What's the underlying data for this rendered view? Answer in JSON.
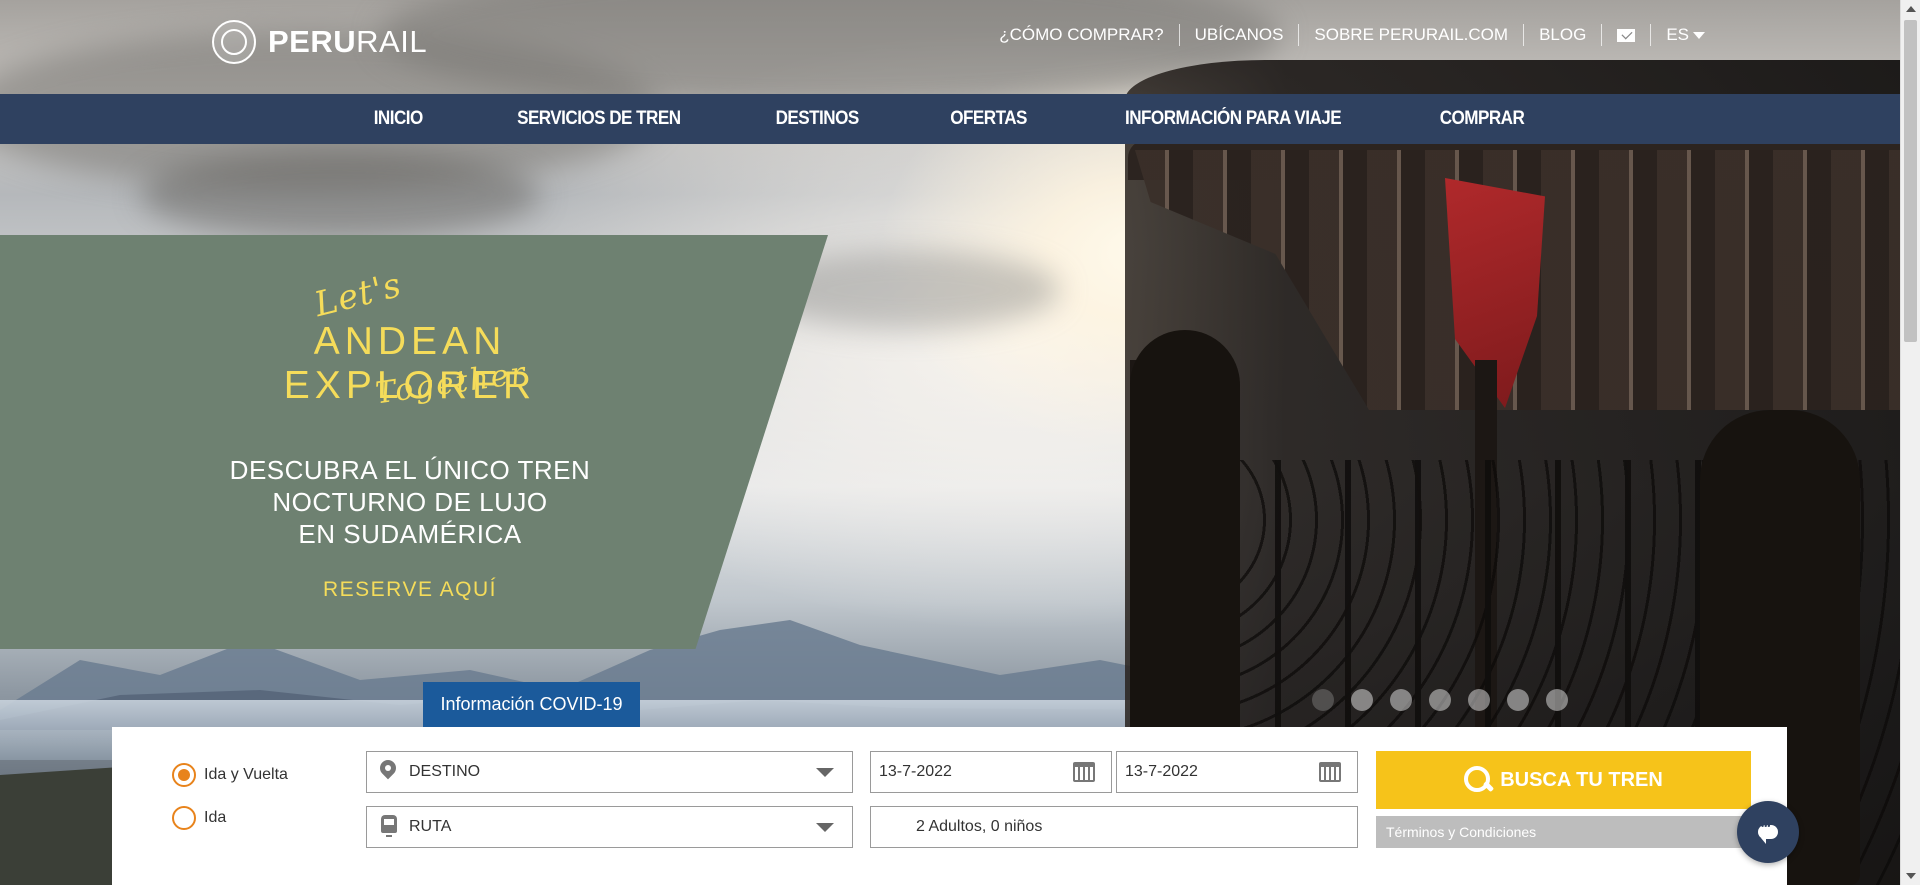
{
  "brand": {
    "name_bold": "PERU",
    "name_rest": "RAIL"
  },
  "top_links": {
    "how_to_buy": "¿CÓMO COMPRAR?",
    "locate_us": "UBÍCANOS",
    "about": "SOBRE PERURAIL.COM",
    "blog": "BLOG",
    "language": "ES",
    "mail_icon": "mail-icon"
  },
  "nav": {
    "items": [
      "INICIO",
      "SERVICIOS DE TREN",
      "DESTINOS",
      "OFERTAS",
      "INFORMACIÓN PARA VIAJE",
      "COMPRAR"
    ]
  },
  "promo": {
    "lets": "Let's",
    "title": "ANDEAN EXPLORER",
    "together": "Together",
    "desc_line1": "DESCUBRA EL ÚNICO TREN",
    "desc_line2": "NOCTURNO DE LUJO",
    "desc_line3": "EN SUDAMÉRICA",
    "cta": "RESERVE AQUÍ"
  },
  "carousel": {
    "slide_count": 7,
    "active_index": 0
  },
  "covid": {
    "label": "Información COVID-19"
  },
  "booking": {
    "trip_type": {
      "round_trip": "Ida y Vuelta",
      "one_way": "Ida",
      "selected": "Ida y Vuelta"
    },
    "destination": "DESTINO",
    "route": "RUTA",
    "depart_date": "13-7-2022",
    "return_date": "13-7-2022",
    "passengers": "2 Adultos, 0 niños",
    "search_label": "BUSCA TU TREN",
    "terms_label": "Términos y Condiciones"
  },
  "colors": {
    "navbar": "#2f4160",
    "promo_panel": "#6e8171",
    "accent_yellow": "#f5dc5a",
    "search_button": "#f6c31a",
    "radio_orange": "#e8831b",
    "covid_tab": "#1b5a9b"
  }
}
